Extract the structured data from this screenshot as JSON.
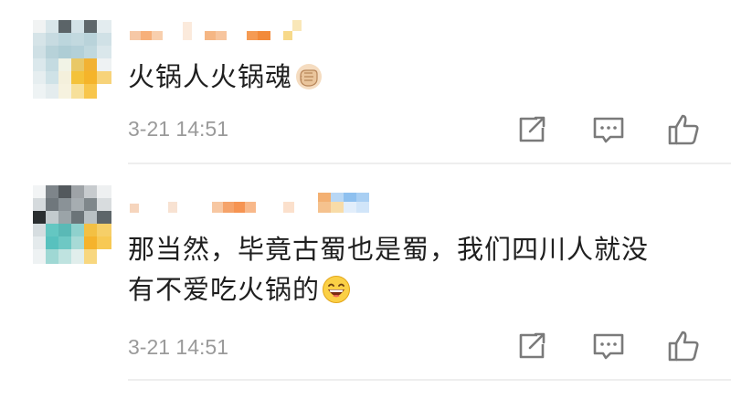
{
  "comments": [
    {
      "text": "火锅人火锅魂",
      "emoji": "fist-emoji",
      "time": "3-21 14:51",
      "actions": [
        "repost-icon",
        "comment-icon",
        "like-icon"
      ]
    },
    {
      "text_line1": "那当然，毕竟古蜀也是蜀，我们四川人就没",
      "text_line2": "有不爱吃火锅的",
      "emoji": "laughing-emoji",
      "time": "3-21 14:51",
      "actions": [
        "repost-icon",
        "comment-icon",
        "like-icon"
      ]
    }
  ],
  "colors": {
    "text": "#1f1f1f",
    "meta": "#9a9a9a",
    "icon": "#7a7a7a",
    "divider": "#eeeeee"
  }
}
